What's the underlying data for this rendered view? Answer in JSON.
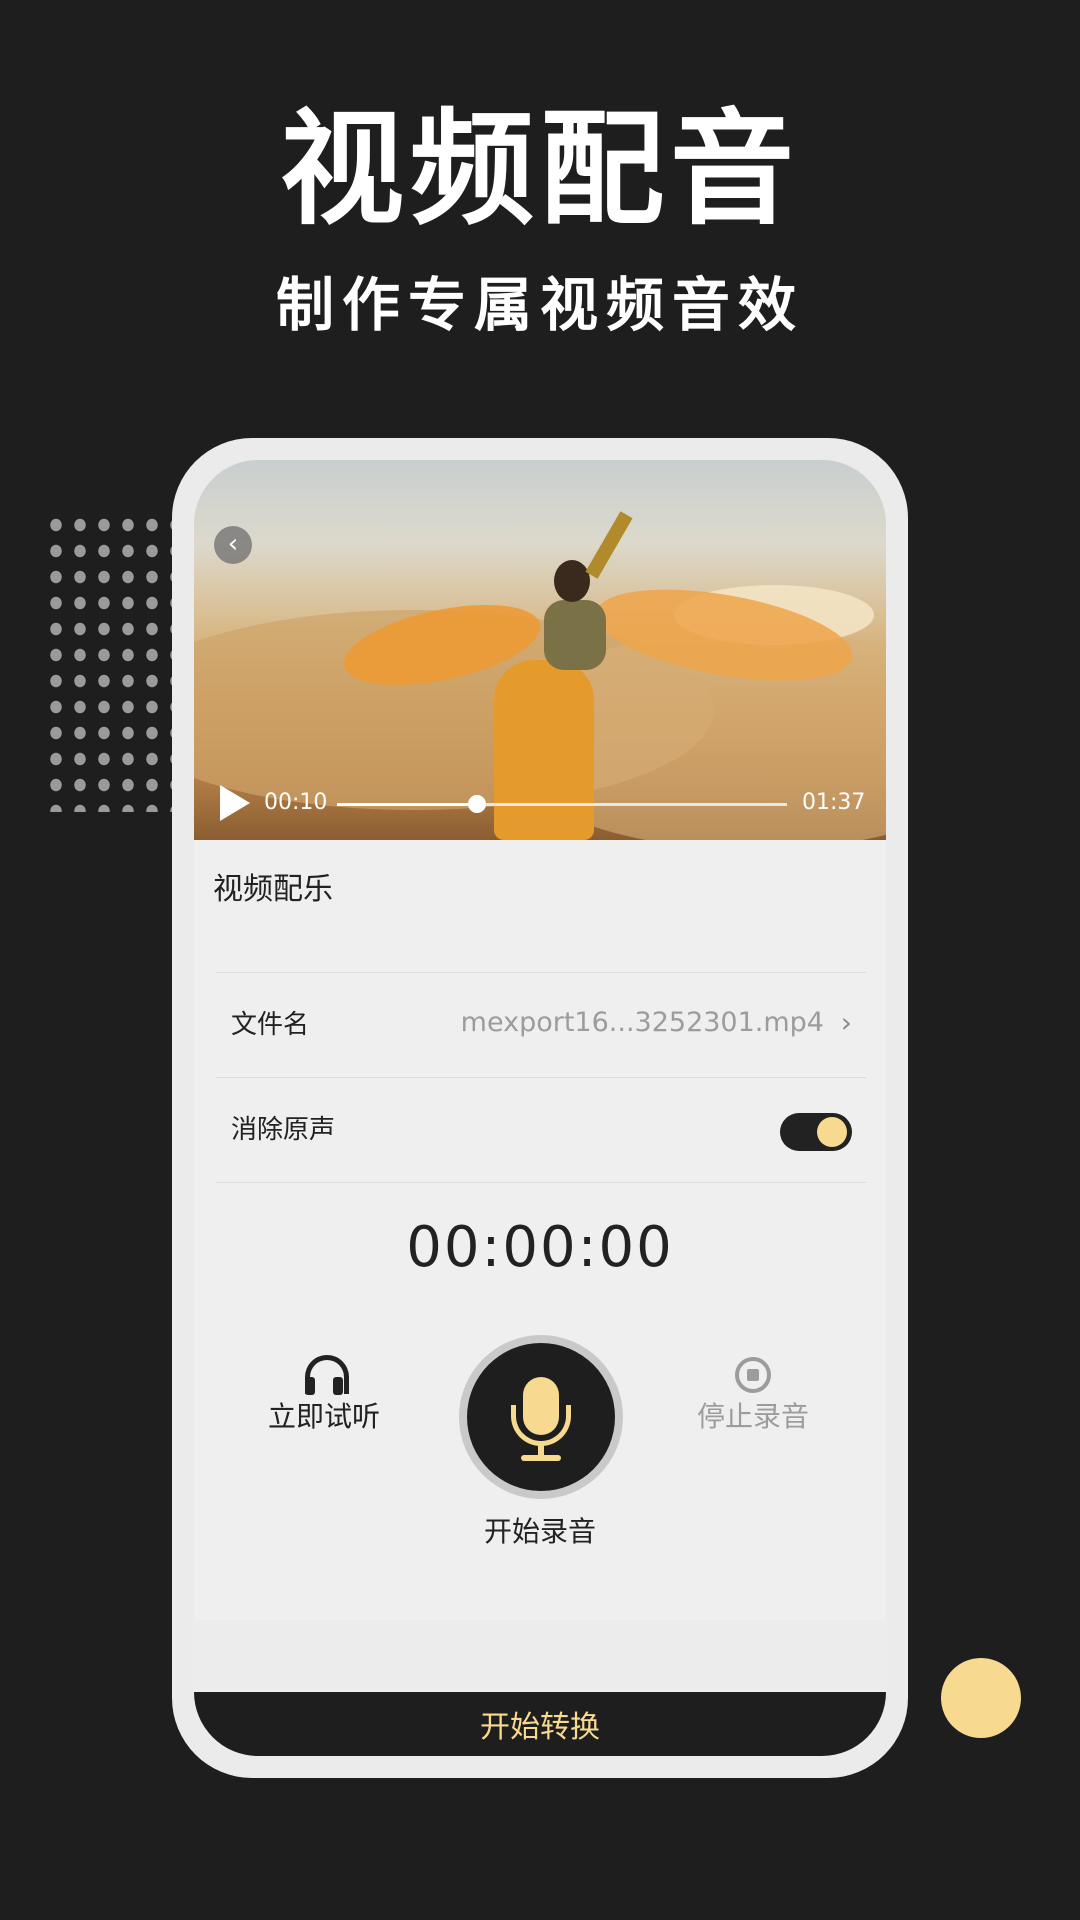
{
  "promo": {
    "title": "视频配音",
    "subtitle": "制作专属视频音效"
  },
  "player": {
    "current_time": "00:10",
    "total_time": "01:37",
    "progress": 0.31
  },
  "section_title": "视频配乐",
  "file_row": {
    "label": "文件名",
    "value": "mexport16...3252301.mp4"
  },
  "mute_row": {
    "label": "消除原声",
    "enabled": true
  },
  "timer": "00:00:00",
  "actions": {
    "listen_label": "立即试听",
    "record_label": "开始录音",
    "stop_label": "停止录音"
  },
  "convert_label": "开始转换",
  "colors": {
    "background": "#1e1e1e",
    "accent": "#f7d98f",
    "panel": "#efefef"
  },
  "icons": [
    "back-icon",
    "play-icon",
    "chevron-right-icon",
    "headphone-icon",
    "microphone-icon",
    "stop-icon"
  ]
}
